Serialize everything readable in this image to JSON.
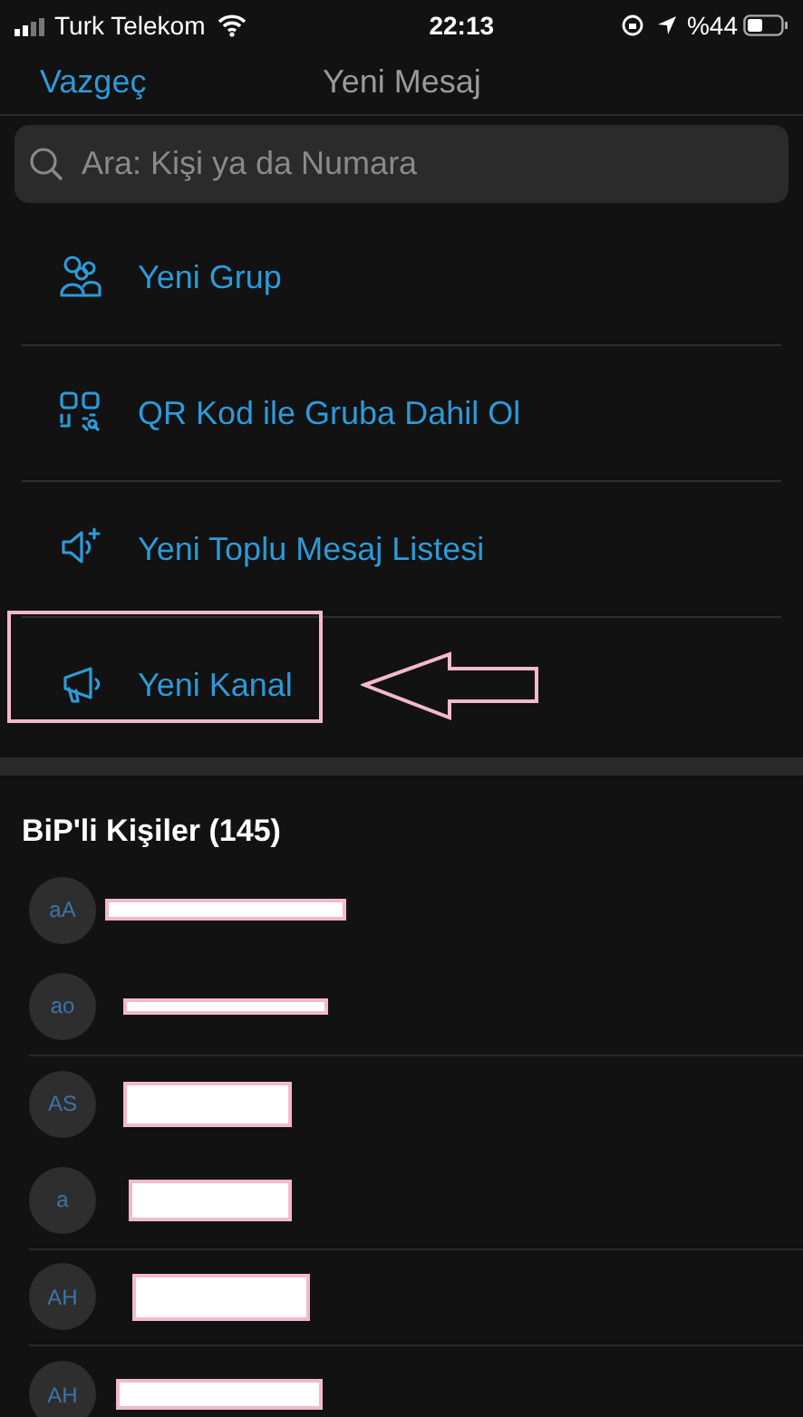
{
  "status_bar": {
    "carrier": "Turk Telekom",
    "time": "22:13",
    "battery": "%44"
  },
  "nav": {
    "cancel": "Vazgeç",
    "title": "Yeni Mesaj"
  },
  "search": {
    "placeholder": "Ara: Kişi ya da Numara"
  },
  "menu": [
    {
      "kind": "group",
      "label": "Yeni Grup"
    },
    {
      "kind": "qr",
      "label": "QR Kod ile Gruba Dahil Ol"
    },
    {
      "kind": "broadcast",
      "label": "Yeni Toplu Mesaj Listesi"
    },
    {
      "kind": "channel",
      "label": "Yeni Kanal"
    }
  ],
  "contacts_header": "BiP'li Kişiler (145)",
  "contacts": [
    {
      "initials": "aA"
    },
    {
      "initials": "ao"
    },
    {
      "initials": "AS"
    },
    {
      "initials": "a"
    },
    {
      "initials": "AH"
    },
    {
      "initials": "AH"
    }
  ]
}
